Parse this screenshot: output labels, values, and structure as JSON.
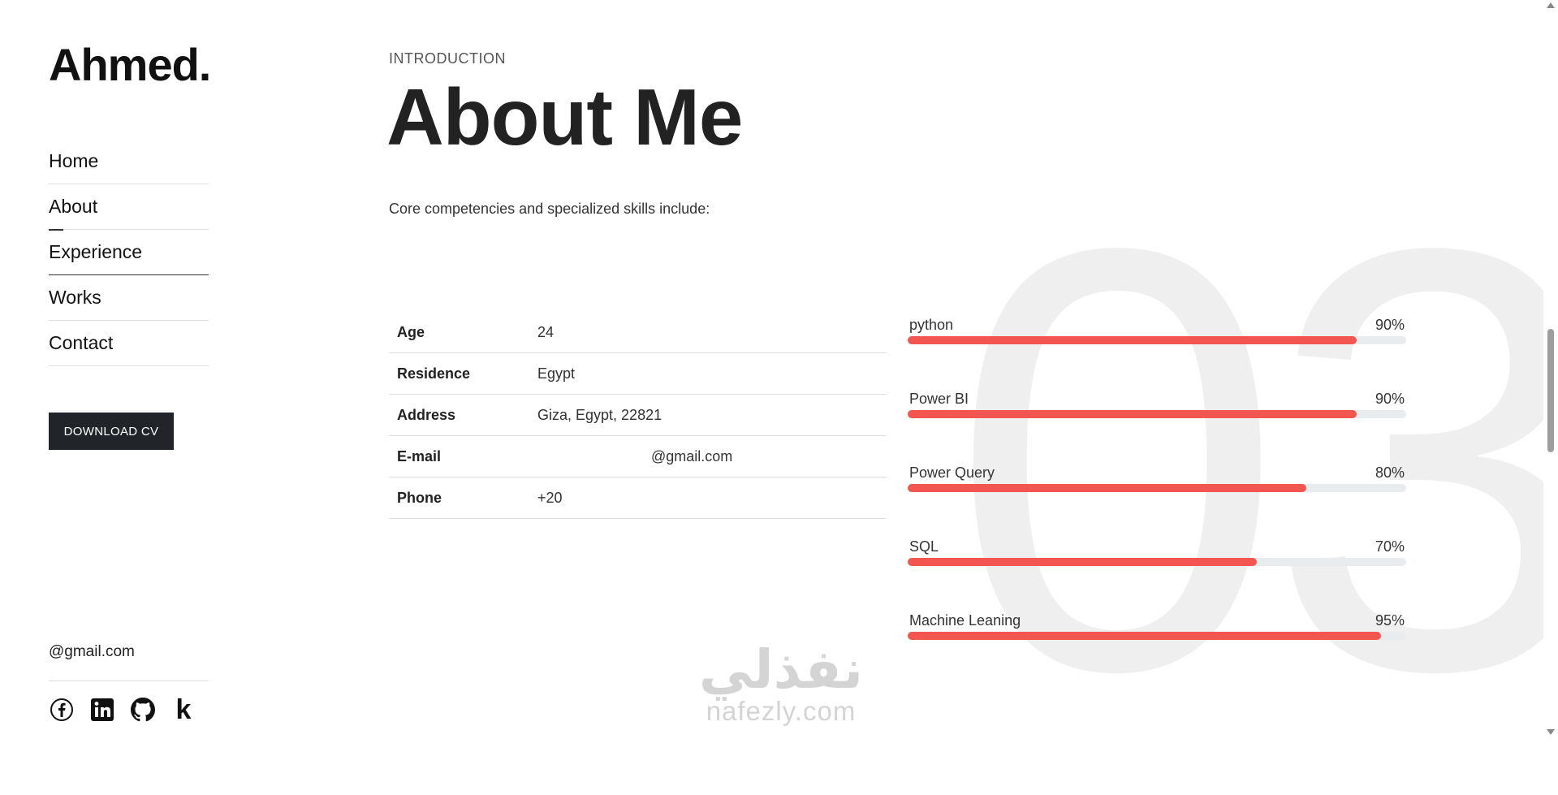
{
  "sidebar": {
    "logo": "Ahmed.",
    "nav": [
      {
        "label": "Home"
      },
      {
        "label": "About"
      },
      {
        "label": "Experience"
      },
      {
        "label": "Works"
      },
      {
        "label": "Contact"
      }
    ],
    "download_label": "DOWNLOAD CV",
    "email": "@gmail.com",
    "socials": [
      "facebook-icon",
      "linkedin-icon",
      "github-icon",
      "kaggle-icon"
    ],
    "kaggle_letter": "k"
  },
  "main": {
    "eyebrow": "INTRODUCTION",
    "title": "About Me",
    "intro": "Core competencies and specialized skills include:",
    "section_number": "03",
    "info": [
      {
        "key": "Age",
        "value": "24"
      },
      {
        "key": "Residence",
        "value": "Egypt"
      },
      {
        "key": "Address",
        "value": "Giza, Egypt, 22821"
      },
      {
        "key": "E-mail",
        "value": "@gmail.com"
      },
      {
        "key": "Phone",
        "value": "+20"
      }
    ],
    "skills": [
      {
        "name": "python",
        "percent_label": "90%",
        "percent": 90
      },
      {
        "name": "Power BI",
        "percent_label": "90%",
        "percent": 90
      },
      {
        "name": "Power Query",
        "percent_label": "80%",
        "percent": 80
      },
      {
        "name": "SQL",
        "percent_label": "70%",
        "percent": 70
      },
      {
        "name": "Machine Leaning",
        "percent_label": "95%",
        "percent": 95
      }
    ],
    "skill_bar_color": "#f35650"
  },
  "watermark": {
    "arabic": "نفذلي",
    "latin": "nafezly.com"
  }
}
